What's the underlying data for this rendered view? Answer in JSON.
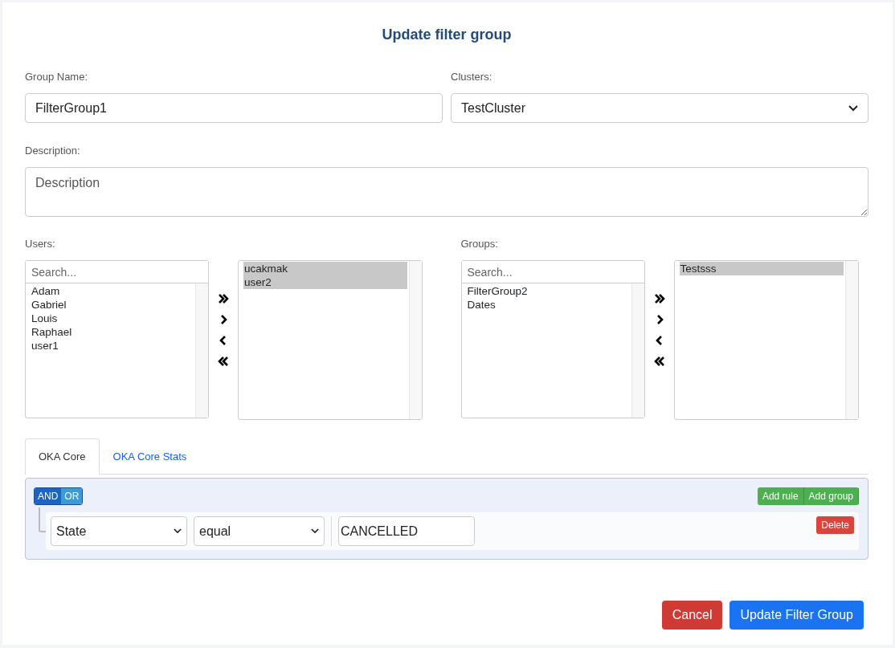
{
  "title": "Update filter group",
  "group_name": {
    "label": "Group Name:",
    "value": "FilterGroup1"
  },
  "clusters": {
    "label": "Clusters:",
    "value": "TestCluster"
  },
  "description": {
    "label": "Description:",
    "placeholder": "Description"
  },
  "pickers": [
    {
      "label": "Users:",
      "search_placeholder": "Search...",
      "available": [
        {
          "text": "Adam",
          "selected": false
        },
        {
          "text": "Gabriel",
          "selected": false
        },
        {
          "text": "Louis",
          "selected": false
        },
        {
          "text": "Raphael",
          "selected": false
        },
        {
          "text": "user1",
          "selected": false
        }
      ],
      "chosen": [
        {
          "text": "ucakmak",
          "selected": true
        },
        {
          "text": "user2",
          "selected": true
        }
      ]
    },
    {
      "label": "Groups:",
      "search_placeholder": "Search...",
      "available": [
        {
          "text": "FilterGroup2",
          "selected": false
        },
        {
          "text": "Dates",
          "selected": false
        }
      ],
      "chosen": [
        {
          "text": "Testsss",
          "selected": true
        }
      ]
    }
  ],
  "tabs": [
    {
      "label": "OKA Core",
      "selected": true
    },
    {
      "label": "OKA Core Stats",
      "selected": false
    }
  ],
  "query": {
    "conditions": [
      {
        "label": "AND",
        "selected": true
      },
      {
        "label": "OR",
        "selected": false
      }
    ],
    "actions": [
      "Add rule",
      "Add group"
    ],
    "rules": [
      {
        "field": "State",
        "operator": "equal",
        "value": "CANCELLED",
        "delete": "Delete"
      }
    ]
  },
  "buttons": [
    {
      "label": "Cancel",
      "kind": "danger"
    },
    {
      "label": "Update Filter Group",
      "kind": "primary"
    }
  ]
}
